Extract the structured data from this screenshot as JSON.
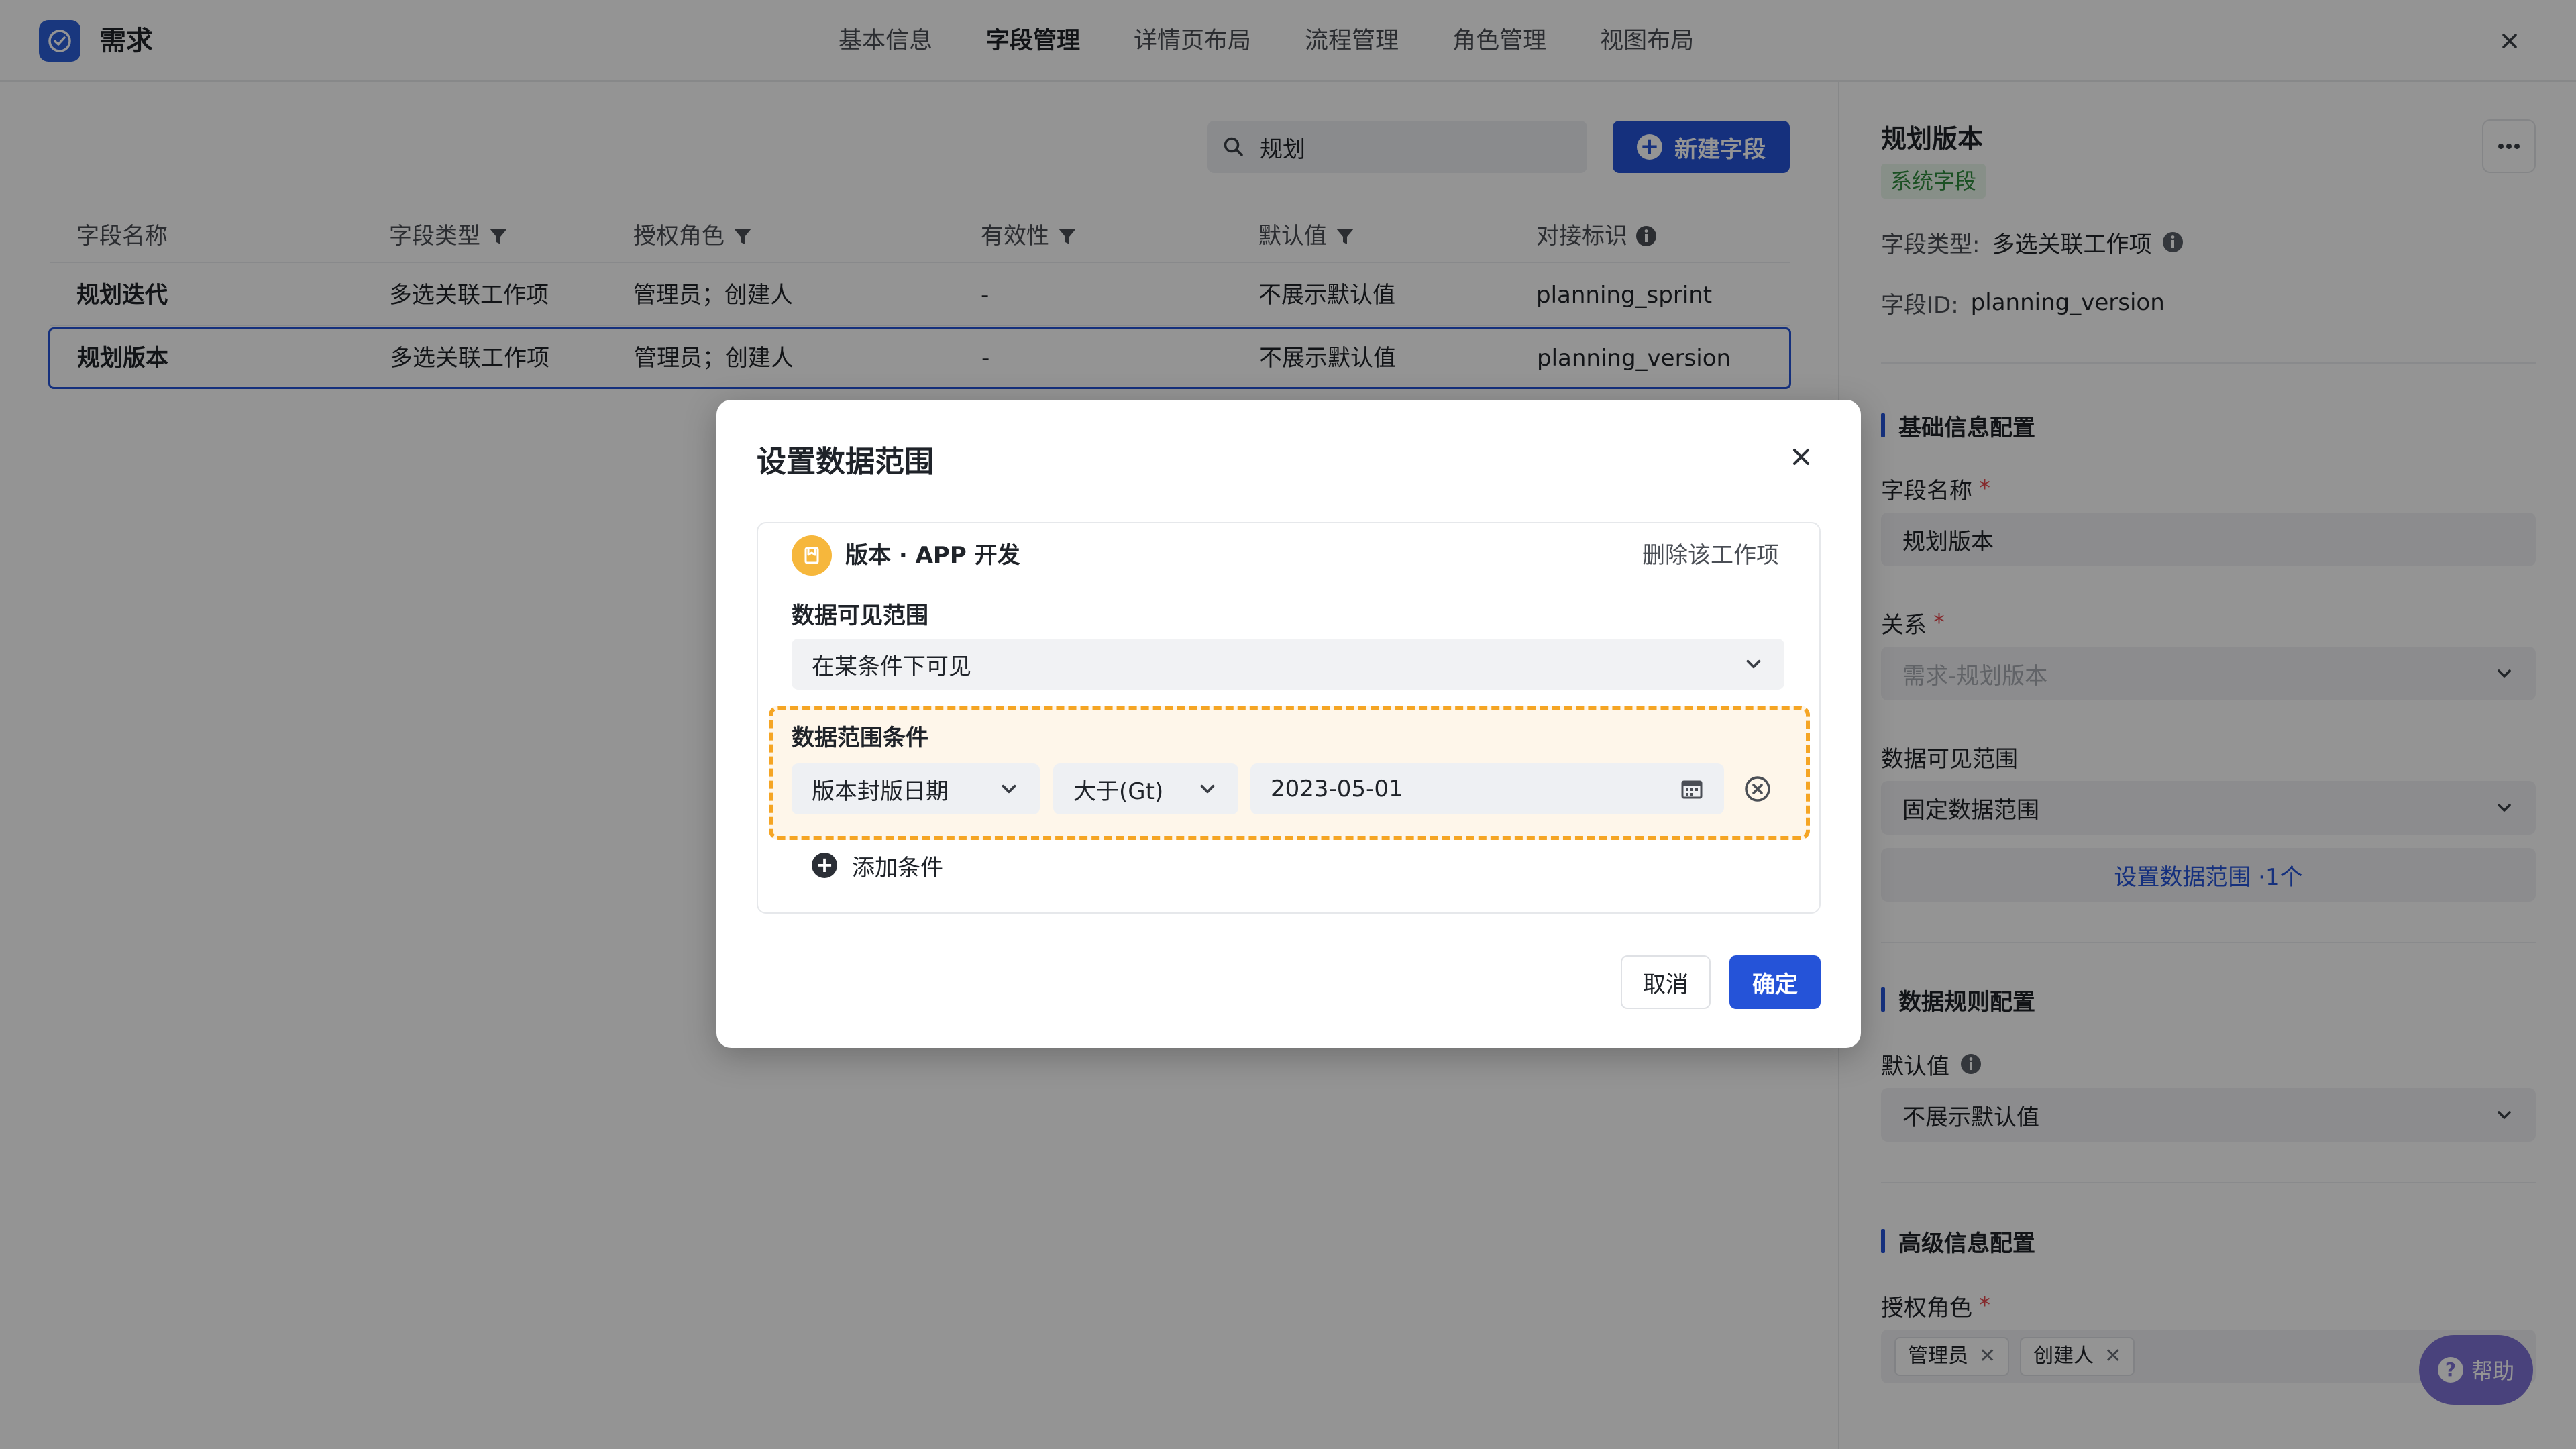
{
  "app": {
    "name": "需求"
  },
  "tabs": [
    {
      "label": "基本信息"
    },
    {
      "label": "字段管理"
    },
    {
      "label": "详情页布局"
    },
    {
      "label": "流程管理"
    },
    {
      "label": "角色管理"
    },
    {
      "label": "视图布局"
    }
  ],
  "toolbar": {
    "search_value": "规划",
    "new_field_label": "新建字段"
  },
  "table": {
    "headers": [
      "字段名称",
      "字段类型",
      "授权角色",
      "有效性",
      "默认值",
      "对接标识"
    ],
    "rows": [
      [
        "规划迭代",
        "多选关联工作项",
        "管理员；创建人",
        "-",
        "不展示默认值",
        "planning_sprint"
      ],
      [
        "规划版本",
        "多选关联工作项",
        "管理员；创建人",
        "-",
        "不展示默认值",
        "planning_version"
      ]
    ]
  },
  "panel": {
    "title": "规划版本",
    "badge": "系统字段",
    "field_type_label": "字段类型:",
    "field_type_value": "多选关联工作项",
    "field_id_label": "字段ID:",
    "field_id_value": "planning_version",
    "section_basic": "基础信息配置",
    "name_label": "字段名称",
    "name_value": "规划版本",
    "relation_label": "关系",
    "relation_value": "需求-规划版本",
    "visible_label": "数据可见范围",
    "visible_value": "固定数据范围",
    "range_link": "设置数据范围 ·1个",
    "section_rules": "数据规则配置",
    "default_label": "默认值",
    "default_value": "不展示默认值",
    "section_adv": "高级信息配置",
    "roles_label": "授权角色",
    "roles": [
      "管理员",
      "创建人"
    ]
  },
  "help": {
    "label": "帮助"
  },
  "modal": {
    "title": "设置数据范围",
    "work_item": "版本 · APP 开发",
    "delete_label": "删除该工作项",
    "visible_label": "数据可见范围",
    "visible_value": "在某条件下可见",
    "condition_label": "数据范围条件",
    "condition_field": "版本封版日期",
    "condition_op": "大于(Gt)",
    "condition_value": "2023-05-01",
    "add_condition": "添加条件",
    "cancel": "取消",
    "ok": "确定"
  }
}
